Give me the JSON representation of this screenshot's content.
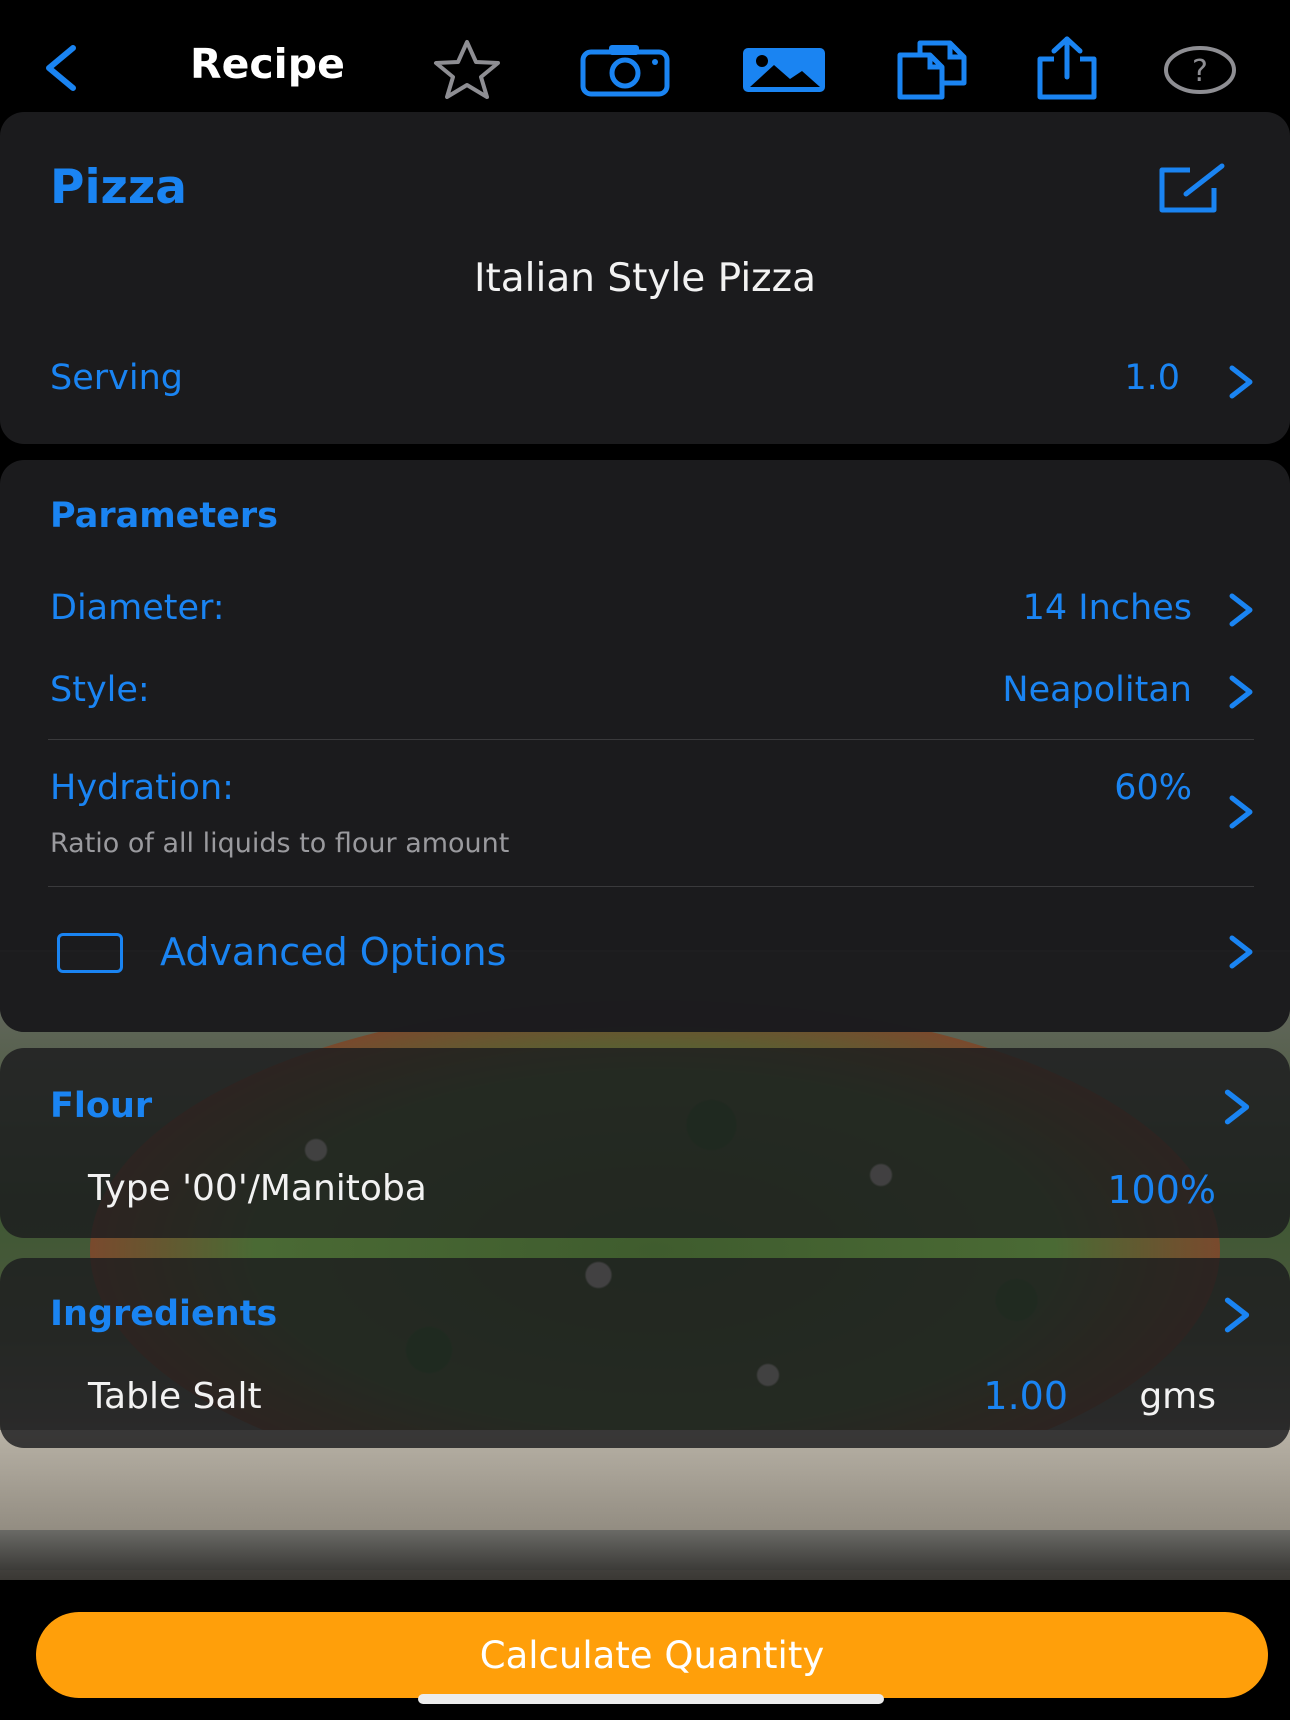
{
  "nav": {
    "title": "Recipe"
  },
  "recipe": {
    "name": "Pizza",
    "description": "Italian Style Pizza",
    "serving_label": "Serving",
    "serving_value": "1.0"
  },
  "parameters": {
    "title": "Parameters",
    "diameter_label": "Diameter:",
    "diameter_value": "14 Inches",
    "style_label": "Style:",
    "style_value": "Neapolitan",
    "hydration_label": "Hydration:",
    "hydration_value": "60%",
    "hydration_subtitle": "Ratio of all liquids to flour amount",
    "advanced_label": "Advanced Options"
  },
  "flour": {
    "title": "Flour",
    "item_name": "Type '00'/Manitoba",
    "item_percent": "100%"
  },
  "ingredients": {
    "title": "Ingredients",
    "item_name": "Table Salt",
    "item_quantity": "1.00",
    "item_unit": "gms"
  },
  "actions": {
    "calculate_label": "Calculate Quantity"
  },
  "colors": {
    "accent": "#1a84f2",
    "button": "#ff9f0a",
    "card": "#1c1c1e"
  },
  "icons": [
    "back-chevron-icon",
    "star-icon",
    "camera-icon",
    "photo-icon",
    "copy-icon",
    "share-icon",
    "help-icon",
    "edit-icon",
    "chevron-right-icon",
    "checkbox-icon"
  ]
}
